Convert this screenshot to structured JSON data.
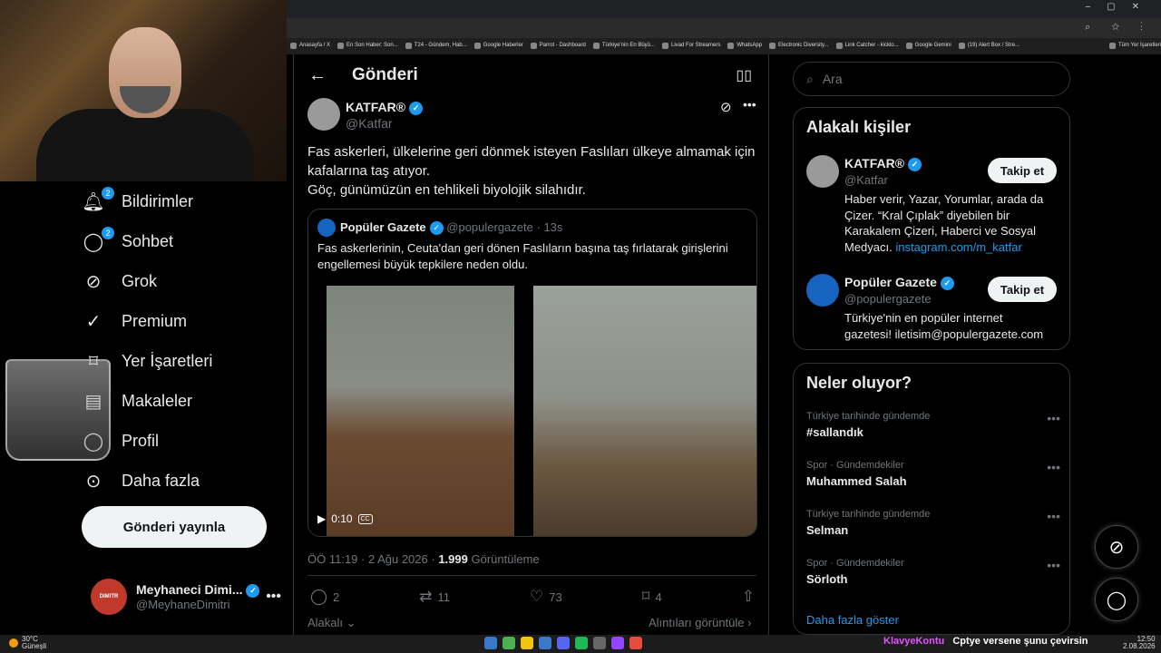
{
  "browser": {
    "bookmarks": [
      "Anasayfa / X",
      "En Son Haber: Son...",
      "T24 - Gündem, Hab...",
      "Google Haberler",
      "Parrot - Dashboard",
      "Türkiye'nin En Büyü...",
      "Livad For Streamers",
      "WhatsApp",
      "Electronic Diversity...",
      "Link Catcher - kicklo...",
      "Google Gemini",
      "(19) Alert Box / Stre...",
      "Tüm Yer İşaretleri"
    ]
  },
  "sidebar": {
    "items": [
      {
        "label": "Bildirimler",
        "icon": "bell-icon",
        "badge": "2"
      },
      {
        "label": "Sohbet",
        "icon": "chat-icon",
        "badge": "2"
      },
      {
        "label": "Grok",
        "icon": "grok-icon",
        "badge": ""
      },
      {
        "label": "Premium",
        "icon": "verified-icon",
        "badge": ""
      },
      {
        "label": "Yer İşaretleri",
        "icon": "bookmark-icon",
        "badge": ""
      },
      {
        "label": "Makaleler",
        "icon": "article-icon",
        "badge": ""
      },
      {
        "label": "Profil",
        "icon": "user-icon",
        "badge": ""
      },
      {
        "label": "Daha fazla",
        "icon": "more-icon",
        "badge": ""
      }
    ],
    "post_button": "Gönderi yayınla",
    "account": {
      "name": "Meyhaneci Dimi...",
      "handle": "@MeyhaneDimitri",
      "avatar_text": "DIMITR"
    }
  },
  "main": {
    "header": {
      "title": "Gönderi"
    },
    "post": {
      "author_name": "KATFAR®",
      "author_handle": "@Katfar",
      "text_line1": "Fas askerleri, ülkelerine geri dönmek isteyen Faslıları ülkeye almamak için",
      "text_line2": "kafalarına taş atıyor.",
      "text_line3": "Göç, günümüzün en tehlikeli biyolojik silahıdır.",
      "quote": {
        "author_name": "Popüler Gazete",
        "author_handle": "@populergazete",
        "time": "· 13s",
        "text_line1": "Fas askerlerinin, Ceuta'dan geri dönen Faslıların başına taş fırlatarak girişlerini",
        "text_line2": "engellemesi büyük tepkilere neden oldu.",
        "video_duration": "0:10",
        "cc": "CC"
      },
      "timestamp": "ÖÖ 11:19 · 2 Ağu 2026 ·",
      "views_count": "1.999",
      "views_label": "Görüntüleme",
      "replies": "2",
      "reposts": "11",
      "likes": "73",
      "bookmarks": "4",
      "related_label": "Alakalı",
      "quotes_label": "Alıntıları görüntüle"
    }
  },
  "right": {
    "search_placeholder": "Ara",
    "related_people": {
      "title": "Alakalı kişiler",
      "people": [
        {
          "name": "KATFAR®",
          "handle": "@Katfar",
          "button": "Takip et",
          "bio_line1": "Haber verir, Yazar, Yorumlar, arada da",
          "bio_line2": "Çizer. “Kral Çıplak” diyebilen bir",
          "bio_line3": "Karakalem Çizeri, Haberci ve Sosyal",
          "bio_line4": "Medyacı.",
          "bio_link": "instagram.com/m_katfar"
        },
        {
          "name": "Popüler Gazete",
          "handle": "@populergazete",
          "button": "Takip et",
          "bio_line1": "Türkiye'nin en popüler internet",
          "bio_line2": "gazetesi! iletisim@populergazete.com"
        }
      ]
    },
    "trends": {
      "title": "Neler oluyor?",
      "items": [
        {
          "category": "Türkiye tarihinde gündemde",
          "name": "#sallandık"
        },
        {
          "category": "Spor · Gündemdekiler",
          "name": "Muhammed Salah"
        },
        {
          "category": "Türkiye tarihinde gündemde",
          "name": "Selman"
        },
        {
          "category": "Spor · Gündemdekiler",
          "name": "Sörloth"
        }
      ],
      "show_more": "Daha fazla göster"
    }
  },
  "taskbar": {
    "weather_temp": "30°C",
    "weather_desc": "Güneşli",
    "ime_label": "KlavyeKontu",
    "ime_text": "Cptye versene şunu çevirsin",
    "clock_time": "12:50",
    "clock_date": "2.08.2026"
  },
  "colors": {
    "accent": "#1d9bf0",
    "background": "#000000",
    "border": "#2f3336",
    "muted": "#71767b"
  }
}
